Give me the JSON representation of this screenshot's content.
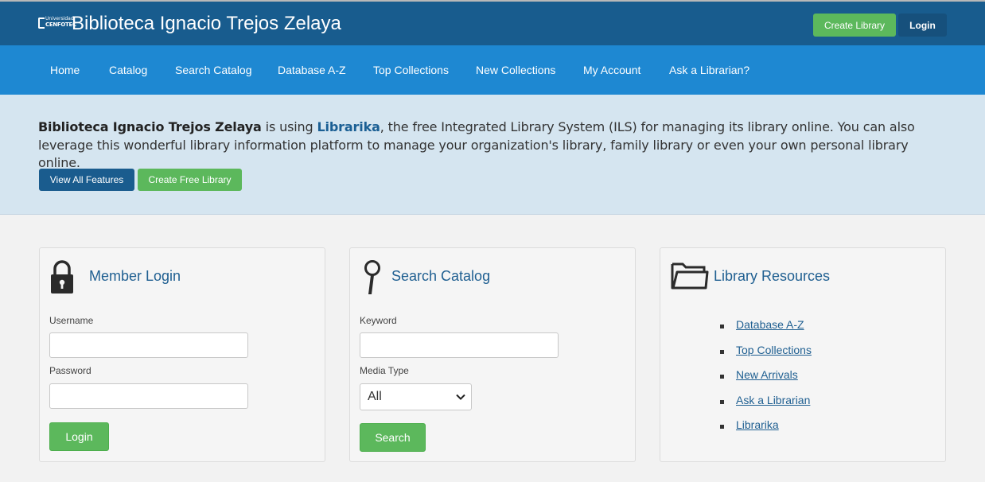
{
  "header": {
    "logo_line1": "Universidad",
    "logo_line2": "CENFOTEC",
    "title": "Biblioteca Ignacio Trejos Zelaya",
    "create_library_label": "Create Library",
    "login_label": "Login",
    "colors": {
      "header_bg": "#185c8e",
      "accent_green": "#5cb85c"
    }
  },
  "nav": {
    "items": [
      "Home",
      "Catalog",
      "Search Catalog",
      "Database A-Z",
      "Top Collections",
      "New Collections",
      "My Account",
      "Ask a Librarian?"
    ],
    "bg_color": "#1e88d2"
  },
  "promo": {
    "library_name": "Biblioteca Ignacio Trejos Zelaya",
    "text_is_using": " is using ",
    "product_name": "Librarika",
    "text_rest": ", the free Integrated Library System (ILS) for managing its library online. You can also leverage this wonderful library information platform to manage your organization's library, family library or even your own personal library online.",
    "view_features_label": "View All Features",
    "create_free_label": "Create Free Library"
  },
  "member_login": {
    "title": "Member Login",
    "icon": "padlock-icon",
    "username_label": "Username",
    "username_value": "",
    "password_label": "Password",
    "password_value": "",
    "login_button": "Login"
  },
  "search_catalog": {
    "title": "Search Catalog",
    "icon": "magnifier-icon",
    "keyword_label": "Keyword",
    "keyword_value": "",
    "media_type_label": "Media Type",
    "media_type_selected": "All",
    "search_button": "Search"
  },
  "library_resources": {
    "title": "Library Resources",
    "icon": "folder-icon",
    "links": [
      "Database A-Z",
      "Top Collections",
      "New Arrivals",
      "Ask a Librarian",
      "Librarika"
    ]
  }
}
